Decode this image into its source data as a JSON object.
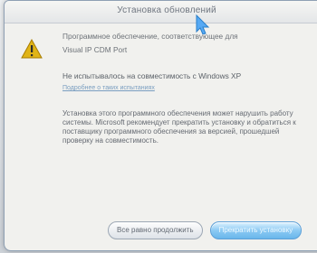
{
  "window": {
    "title": "Установка обновлений"
  },
  "dialog": {
    "line1": "Программное обеспечение, соответствующее для",
    "line2": "Visual IP CDM Port",
    "compat_title": "Не испытывалось на совместимость с Windows XP",
    "compat_link": "Подробнее о таких испытаниях",
    "warning_text": "Установка этого программного обеспечения может нарушить работу системы. Microsoft рекомендует прекратить установку и обратиться к поставщику программного обеспечения за версией, прошедшей проверку на совместимость."
  },
  "buttons": {
    "continue_label": "Все равно продолжить",
    "stop_label": "Прекратить установку"
  },
  "colors": {
    "accent": "#69b6eb",
    "warning": "#e0b417",
    "link": "#7a9ec0"
  },
  "icons": {
    "warning": "warning-icon",
    "pointer": "mouse-pointer-icon"
  }
}
